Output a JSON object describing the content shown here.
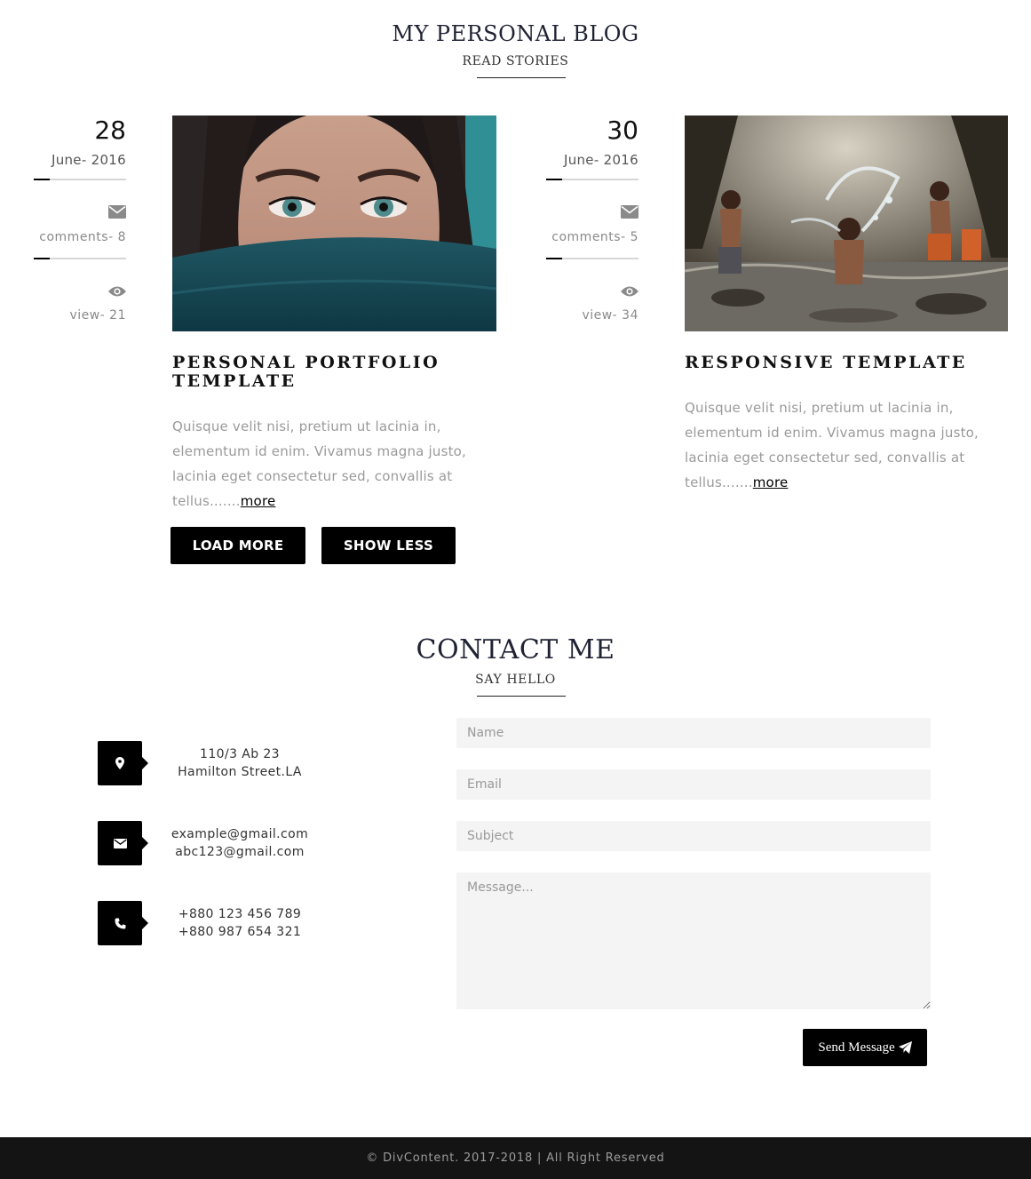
{
  "blog": {
    "title": "MY PERSONAL BLOG",
    "subtitle": "READ STORIES",
    "posts": [
      {
        "day": "28",
        "month": "June- 2016",
        "comments": "comments- 8",
        "views": "view- 21",
        "title_line1": "PERSONAL PORTFOLIO",
        "title_line2": "TEMPLATE",
        "excerpt": "Quisque velit nisi, pretium ut lacinia in, elementum id enim. Vivamus magna justo, lacinia eget consectetur sed, convallis at tellus.......",
        "more": "more"
      },
      {
        "day": "30",
        "month": "June- 2016",
        "comments": "comments- 5",
        "views": "view- 34",
        "title_line1": "RESPONSIVE TEMPLATE",
        "title_line2": "",
        "excerpt": "Quisque velit nisi, pretium ut lacinia in, elementum id enim. Vivamus magna justo, lacinia eget consectetur sed, convallis at tellus.......",
        "more": "more"
      }
    ],
    "load_more": "LOAD MORE",
    "show_less": "SHOW LESS"
  },
  "contact": {
    "title": "CONTACT ME",
    "subtitle": "SAY HELLO",
    "address_line1": "110/3 Ab 23",
    "address_line2": "Hamilton Street.LA",
    "email_line1": "example@gmail.com",
    "email_line2": "abc123@gmail.com",
    "phone_line1": "+880 123 456 789",
    "phone_line2": "+880 987 654 321",
    "form": {
      "name_placeholder": "Name",
      "email_placeholder": "Email",
      "subject_placeholder": "Subject",
      "message_placeholder": "Message...",
      "send_label": "Send Message"
    }
  },
  "footer": {
    "text": "© DivContent. 2017-2018 | All Right Reserved"
  },
  "icons": {
    "date": "envelope-icon",
    "views": "eye-icon",
    "address": "map-marker-icon",
    "email": "envelope-icon",
    "phone": "phone-icon",
    "send": "paper-plane-icon"
  }
}
